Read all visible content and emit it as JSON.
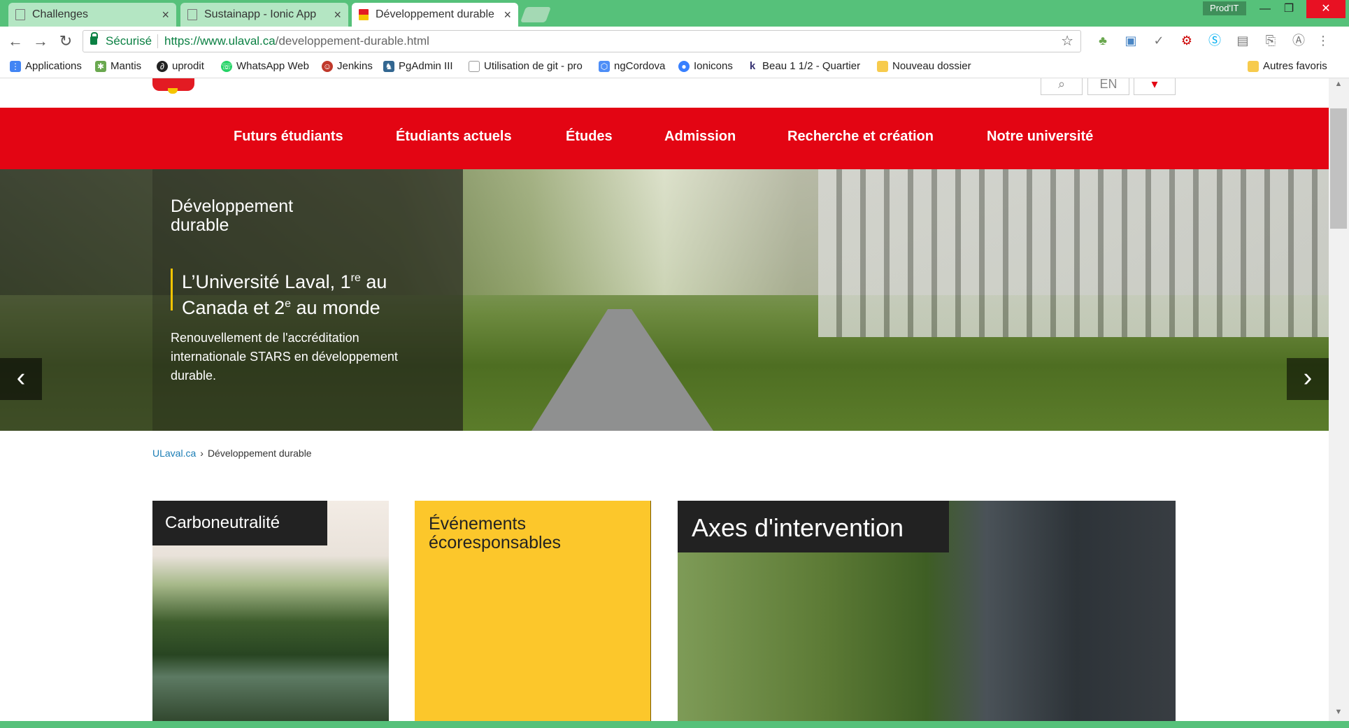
{
  "browser": {
    "tabs": [
      {
        "label": "Challenges",
        "close": "×"
      },
      {
        "label": "Sustainapp - Ionic App",
        "close": "×"
      },
      {
        "label": "Développement durable",
        "close": "×"
      }
    ],
    "profile": "Prod'IT",
    "window_controls": {
      "minimize": "—",
      "maximize": "❐",
      "close": "✕"
    },
    "nav": {
      "back": "←",
      "forward": "→",
      "reload": "↻"
    },
    "secure_label": "Sécurisé",
    "url": {
      "origin": "https://www.ulaval.ca",
      "path": "/developpement-durable.html"
    },
    "star": "☆",
    "bookmarks": [
      {
        "label": "Applications",
        "icon": "apps-icon",
        "color": "#4285f4"
      },
      {
        "label": "Mantis",
        "icon": "mantis-icon",
        "color": "#6aa84f"
      },
      {
        "label": "uprodit",
        "icon": "uprodit-icon",
        "color": "#222222"
      },
      {
        "label": "WhatsApp Web",
        "icon": "whatsapp-icon",
        "color": "#25d366"
      },
      {
        "label": "Jenkins",
        "icon": "jenkins-icon",
        "color": "#c0392b"
      },
      {
        "label": "PgAdmin III",
        "icon": "pgadmin-icon",
        "color": "#336791"
      },
      {
        "label": "Utilisation de git - pro",
        "icon": "page-icon",
        "color": "#999999"
      },
      {
        "label": "ngCordova",
        "icon": "ngcordova-icon",
        "color": "#4e8ef7"
      },
      {
        "label": "Ionicons",
        "icon": "ionicons-icon",
        "color": "#3880ff"
      },
      {
        "label": "Beau 1 1/2 - Quartier",
        "icon": "kijiji-icon",
        "color": "#373373"
      },
      {
        "label": "Nouveau dossier",
        "icon": "folder-icon",
        "color": "#f7cb4d"
      }
    ],
    "other_bookmarks": "Autres favoris"
  },
  "header": {
    "lang": "EN"
  },
  "nav": {
    "items": [
      "Futurs étudiants",
      "Étudiants actuels",
      "Études",
      "Admission",
      "Recherche et création",
      "Notre université"
    ]
  },
  "hero": {
    "section_title": "Développement durable",
    "heading_part1": "L’Université Laval, 1",
    "heading_sup1": "re",
    "heading_part2": " au Canada et 2",
    "heading_sup2": "e",
    "heading_part3": " au monde",
    "description": "Renouvellement de l'accréditation internationale STARS en développement durable.",
    "prev": "‹",
    "next": "›"
  },
  "breadcrumb": {
    "home": "ULaval.ca",
    "separator": "›",
    "current": "Développement durable"
  },
  "cards": [
    {
      "title": "Carboneutralité"
    },
    {
      "title": "Événements écoresponsables"
    },
    {
      "title": "Axes d'intervention"
    }
  ],
  "colors": {
    "brand_red": "#e30513",
    "brand_yellow": "#fcc72b",
    "chrome_green": "#56c17a"
  }
}
